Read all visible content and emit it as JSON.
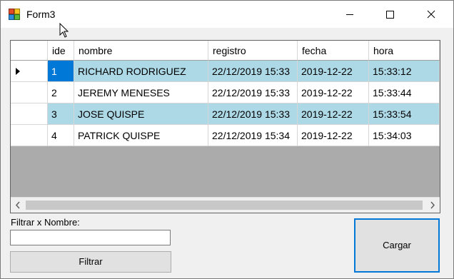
{
  "window": {
    "title": "Form3",
    "minimize_glyph": "—",
    "maximize_glyph": "☐",
    "close_glyph": "✕"
  },
  "grid": {
    "columns": [
      "ide",
      "nombre",
      "registro",
      "fecha",
      "hora"
    ],
    "rows": [
      {
        "ide": "1",
        "nombre": "RICHARD RODRIGUEZ",
        "registro": "22/12/2019 15:33",
        "fecha": "2019-12-22",
        "hora": "15:33:12"
      },
      {
        "ide": "2",
        "nombre": "JEREMY MENESES",
        "registro": "22/12/2019 15:33",
        "fecha": "2019-12-22",
        "hora": "15:33:44"
      },
      {
        "ide": "3",
        "nombre": "JOSE QUISPE",
        "registro": "22/12/2019 15:33",
        "fecha": "2019-12-22",
        "hora": "15:33:54"
      },
      {
        "ide": "4",
        "nombre": "PATRICK QUISPE",
        "registro": "22/12/2019 15:34",
        "fecha": "2019-12-22",
        "hora": "15:34:03"
      }
    ],
    "current_row_indicator": "row-pointer-icon",
    "alternating_row_color": "#add8e6",
    "selection_color": "#0078d7",
    "empty_area_color": "#ababab"
  },
  "filter": {
    "label": "Filtrar x Nombre:",
    "value": "",
    "button_label": "Filtrar"
  },
  "load_button": {
    "label": "Cargar"
  }
}
